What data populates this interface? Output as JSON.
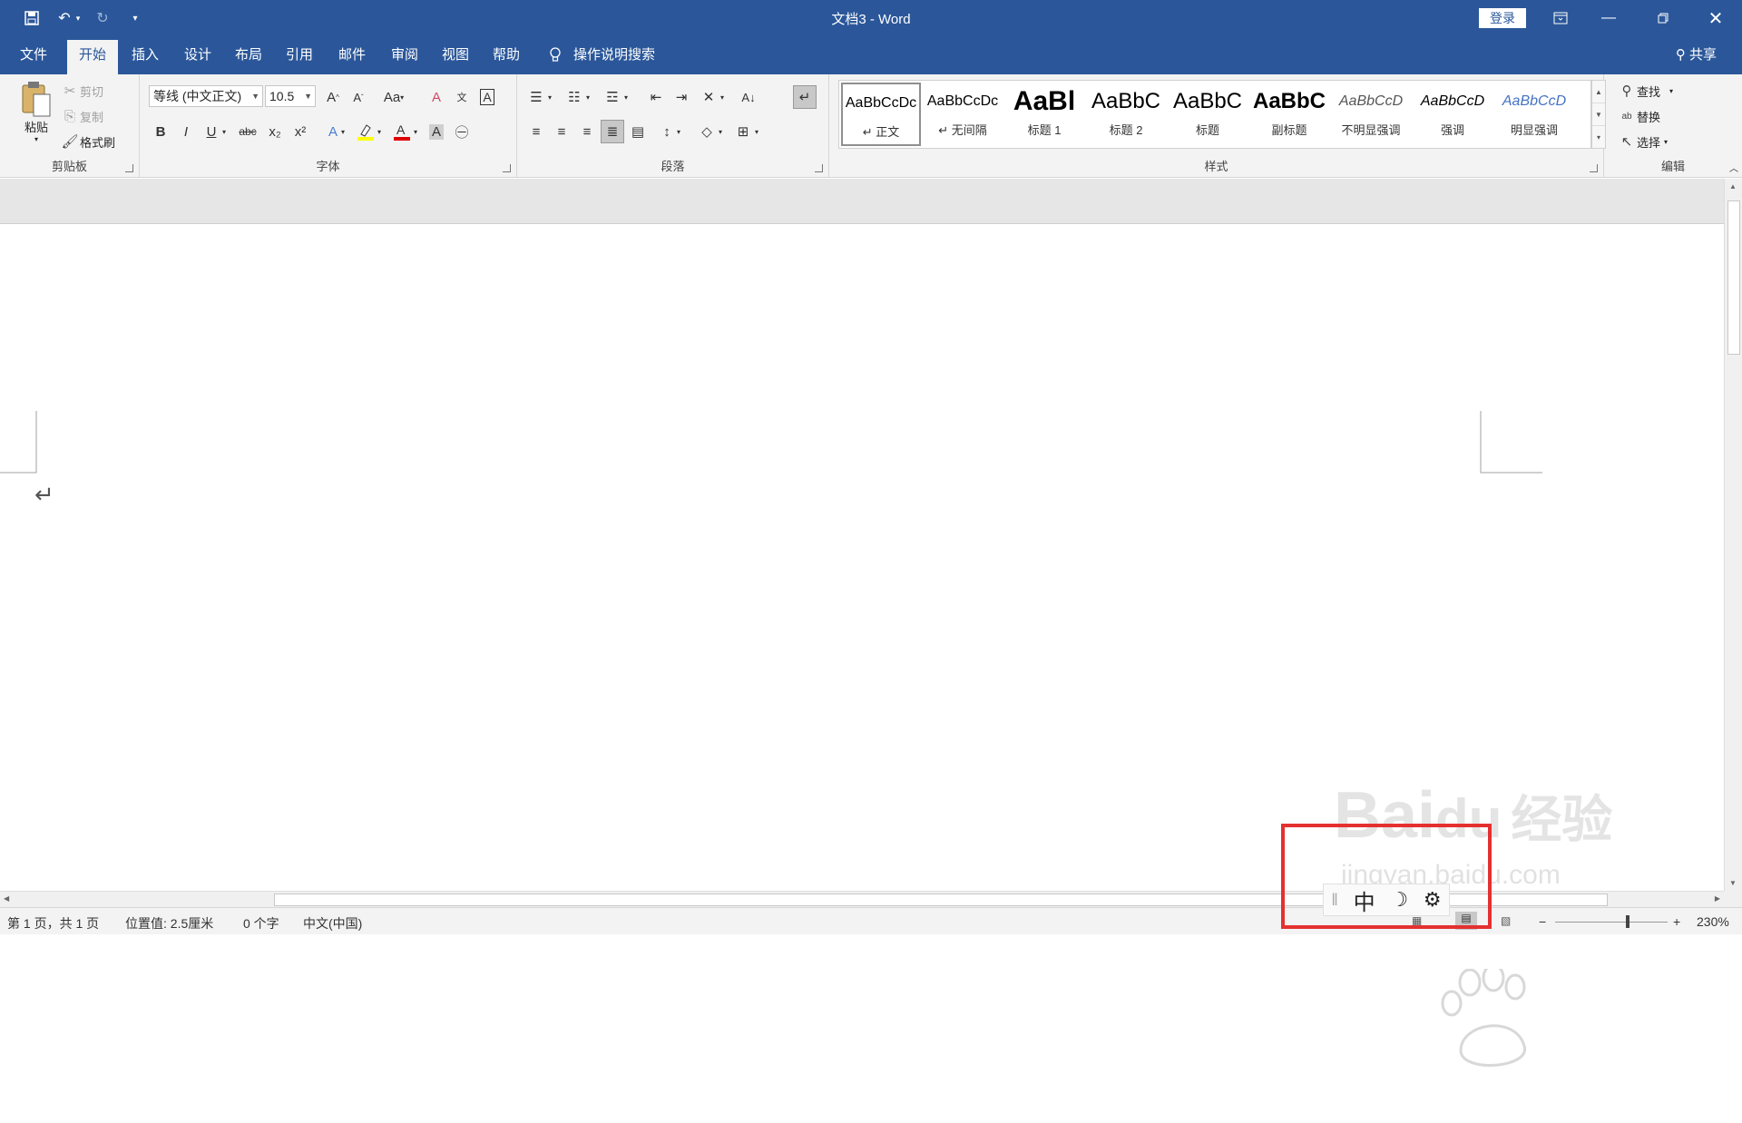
{
  "titlebar": {
    "title": "文档3  -  Word",
    "login": "登录"
  },
  "tabs": {
    "file": "文件",
    "home": "开始",
    "insert": "插入",
    "design": "设计",
    "layout": "布局",
    "references": "引用",
    "mailings": "邮件",
    "review": "审阅",
    "view": "视图",
    "help": "帮助",
    "tell_me": "操作说明搜索",
    "share": "共享"
  },
  "clipboard": {
    "paste": "粘贴",
    "cut": "剪切",
    "copy": "复制",
    "format_painter": "格式刷",
    "label": "剪贴板"
  },
  "font": {
    "font_name": "等线 (中文正文)",
    "font_size": "10.5",
    "case": "Aa",
    "label": "字体",
    "bold": "B",
    "italic": "I",
    "underline": "U",
    "strike": "abc",
    "sub": "x₂",
    "sup": "x²"
  },
  "paragraph": {
    "label": "段落"
  },
  "styles": {
    "label": "样式",
    "items": [
      {
        "preview": "AaBbCcDc",
        "name": "↵ 正文"
      },
      {
        "preview": "AaBbCcDc",
        "name": "↵ 无间隔"
      },
      {
        "preview": "AaBl",
        "name": "标题 1"
      },
      {
        "preview": "AaBbC",
        "name": "标题 2"
      },
      {
        "preview": "AaBbC",
        "name": "标题"
      },
      {
        "preview": "AaBbC",
        "name": "副标题"
      },
      {
        "preview": "AaBbCcD",
        "name": "不明显强调"
      },
      {
        "preview": "AaBbCcD",
        "name": "强调"
      },
      {
        "preview": "AaBbCcD",
        "name": "明显强调"
      }
    ]
  },
  "editing": {
    "find": "查找",
    "replace": "替换",
    "select": "选择",
    "label": "编辑"
  },
  "document": {
    "paragraph_mark": "↵"
  },
  "status": {
    "page": "第 1 页，共 1 页",
    "position": "位置值: 2.5厘米",
    "words": "0 个字",
    "language": "中文(中国)",
    "zoom": "230%"
  },
  "ime": {
    "mode": "中",
    "punct": "☽"
  },
  "watermark": {
    "brand": "Bai",
    "brand2": "du",
    "cn": "经验",
    "url": "jingyan.baidu.com"
  }
}
